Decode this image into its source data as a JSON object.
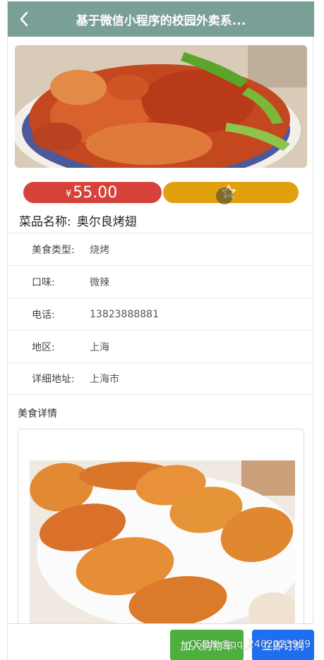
{
  "header": {
    "title": "基于微信小程序的校园外卖系...",
    "back_icon": "chevron-left-icon"
  },
  "banner": {
    "image": "crayfish-dish-photo"
  },
  "price": {
    "currency": "¥",
    "value": "55.00"
  },
  "favorite": {
    "icon": "star-outline-icon"
  },
  "dish": {
    "name_label": "菜品名称:",
    "name_value": "奥尔良烤翅"
  },
  "info": [
    {
      "label": "美食类型:",
      "value": "烧烤"
    },
    {
      "label": "口味:",
      "value": "微辣"
    },
    {
      "label": "电话:",
      "value": "13823888881"
    },
    {
      "label": "地区:",
      "value": "上海"
    },
    {
      "label": "详细地址:",
      "value": "上海市"
    }
  ],
  "detail": {
    "title": "美食详情",
    "image": "grilled-chicken-wings-photo"
  },
  "actions": {
    "add_to_cart": "加入购物车",
    "buy_now": "立即订购"
  },
  "watermark": "CSDN @qq_2402023979",
  "colors": {
    "header": "#7a9f97",
    "price": "#d6423a",
    "favorite": "#e1a10e",
    "cart": "#4caf3e",
    "buy": "#1e6ff0"
  }
}
